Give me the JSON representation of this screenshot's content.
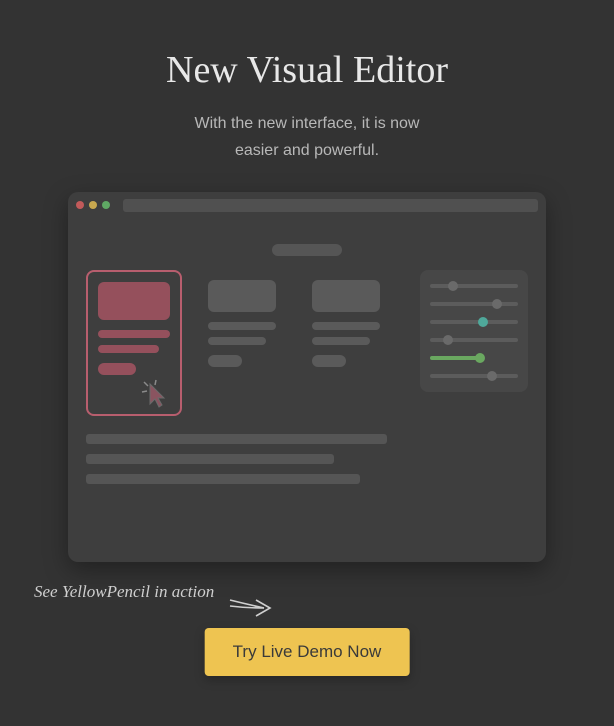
{
  "hero": {
    "title": "New Visual Editor",
    "subtitle_line1": "With the new interface, it is now",
    "subtitle_line2": "easier and powerful."
  },
  "callout": {
    "text": "See YellowPencil in action"
  },
  "cta": {
    "label": "Try Live Demo Now"
  }
}
